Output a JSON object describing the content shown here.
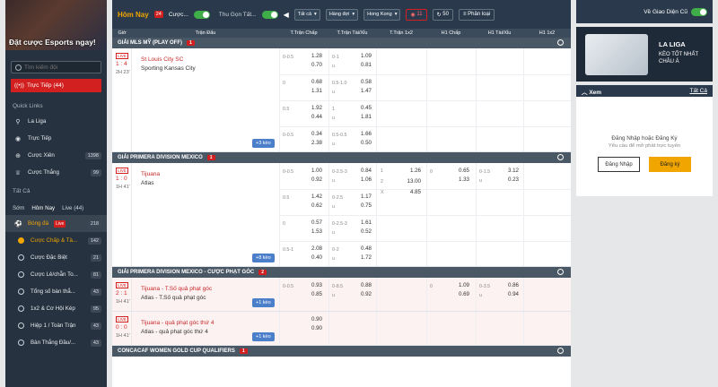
{
  "sidebar": {
    "banner_text": "Đặt cược Esports ngay!",
    "search_placeholder": "Tìm kiếm đội",
    "live_label": "Trực Tiếp (44)",
    "quick_links_title": "Quick Links",
    "quick_links": [
      {
        "label": "La Liga",
        "icon": "football-boot-icon",
        "count": ""
      },
      {
        "label": "Trực Tiếp",
        "icon": "live-signal-icon",
        "count": ""
      },
      {
        "label": "Cược Xiên",
        "icon": "parlay-icon",
        "count": "1398"
      },
      {
        "label": "Cược Thắng",
        "icon": "trophy-icon",
        "count": "99"
      }
    ],
    "all_title": "Tất Cả",
    "tabs": [
      "Sớm",
      "Hôm Nay",
      "Live (44)"
    ],
    "sport": {
      "label": "Bóng đá",
      "live": "Live",
      "count": "218"
    },
    "bet_types": [
      {
        "label": "Cược Chấp & Tà...",
        "count": "142",
        "selected": true
      },
      {
        "label": "Cược Đặc Biệt",
        "count": "21",
        "selected": false
      },
      {
        "label": "Cược Lẻ/chẵn To...",
        "count": "81",
        "selected": false
      },
      {
        "label": "Tổng số bàn thắ...",
        "count": "43",
        "selected": false
      },
      {
        "label": "1x2 & Cơ Hội Kép",
        "count": "95",
        "selected": false
      },
      {
        "label": "Hiệp 1 / Toàn Trận",
        "count": "43",
        "selected": false
      },
      {
        "label": "Bàn Thắng Đầu/...",
        "count": "43",
        "selected": false
      }
    ]
  },
  "topbar": {
    "title": "Hôm Nay",
    "count": "24",
    "filter": "Cược...",
    "collapse": "Thu Gọn Tất...",
    "select1": "Tất cả",
    "select2": "Hàng đợi",
    "select3": "Hong Kong",
    "live_count": "11",
    "timer": "50",
    "sort": "Phân loại"
  },
  "columns": [
    "Giờ",
    "Trận Đấu",
    "T.Trận Chấp",
    "T.Trận Tài/Xỉu",
    "T.Trận 1x2",
    "H1 Chấp",
    "H1 Tài/Xỉu",
    "H1 1x2"
  ],
  "leagues": [
    {
      "name": "GIẢI MLS MỸ (PLAY OFF)",
      "count": "1",
      "matches": [
        {
          "live": "LIVE",
          "score": "1 : 4",
          "clock": "2H 23'",
          "home": "St Louis City SC",
          "away": "Sporting Kansas City",
          "more": "+3 kèo",
          "lines": [
            {
              "hdp": "0-0.5",
              "h1": "1.28",
              "h2": "0.70",
              "ou": "0-1",
              "o1": "1.09",
              "o2": "0.81",
              "ul": "u"
            },
            {
              "hdp": "0",
              "h1": "0.68",
              "h2": "1.31",
              "ou": "0.5-1.0",
              "o1": "0.58",
              "o2": "1.47",
              "ul": "u"
            },
            {
              "hdp": "0.5",
              "h1": "1.92",
              "h2": "0.44",
              "ou": "1",
              "o1": "0.45",
              "o2": "1.81",
              "ul": "u"
            },
            {
              "hdp": "0-0.5",
              "h1": "0.34",
              "h2": "2.38",
              "ou": "0.5-0.5",
              "o1": "1.66",
              "o2": "0.50",
              "ul": "u"
            }
          ]
        }
      ]
    },
    {
      "name": "GIẢI PRIMERA DIVISION MEXICO",
      "count": "1",
      "matches": [
        {
          "live": "LIVE",
          "score": "1 : 0",
          "clock": "1H 41'",
          "home": "Tijuana",
          "away": "Atlas",
          "more": "+8 kèo",
          "x12": [
            {
              "k": "1",
              "v": "1.26"
            },
            {
              "k": "2",
              "v": "13.00"
            },
            {
              "k": "X",
              "v": "4.85"
            }
          ],
          "h1hdp": {
            "l": "0",
            "a": "0.65",
            "b": "1.33"
          },
          "h1ou": {
            "l": "0-1.5",
            "a": "3.12",
            "b": "0.23",
            "ul": "u"
          },
          "lines": [
            {
              "hdp": "0-0.5",
              "h1": "1.00",
              "h2": "0.92",
              "ou": "0-2.5-3",
              "o1": "0.84",
              "o2": "1.06",
              "ul": "u"
            },
            {
              "hdp": "0.5",
              "h1": "1.42",
              "h2": "0.62",
              "ou": "0-2.5",
              "o1": "1.17",
              "o2": "0.75",
              "ul": "u"
            },
            {
              "hdp": "0",
              "h1": "0.57",
              "h2": "1.53",
              "ou": "0-2.5-3",
              "o1": "1.61",
              "o2": "0.52",
              "ul": "u"
            },
            {
              "hdp": "0.5-1",
              "h1": "2.08",
              "h2": "0.40",
              "ou": "0-2",
              "o1": "0.48",
              "o2": "1.72",
              "ul": "u"
            }
          ]
        }
      ]
    },
    {
      "name": "GIẢI PRIMERA DIVISION MEXICO - CƯỢC PHẠT GÓC",
      "count": "2",
      "matches": [
        {
          "live": "LIVE",
          "score": "2 : 1",
          "clock": "1H 41'",
          "home": "Tijuana - T.Số quả phạt góc",
          "away": "Atlas - T.Số quả phạt góc",
          "more": "+1 kèo",
          "h1hdp": {
            "l": "0",
            "a": "1.09",
            "b": "0.69"
          },
          "h1ou": {
            "l": "0-3.5",
            "a": "0.86",
            "b": "0.94",
            "ul": "u"
          },
          "lines": [
            {
              "hdp": "0-0.5",
              "h1": "0.93",
              "h2": "0.85",
              "ou": "0-8.5",
              "o1": "0.88",
              "o2": "0.92",
              "ul": "u"
            }
          ]
        },
        {
          "live": "LIVE",
          "score": "0 : 0",
          "clock": "1H 41'",
          "home": "Tijuana - quả phạt góc thứ 4",
          "away": "Atlas - quả phạt góc thứ 4",
          "more": "+1 kèo",
          "lines": [
            {
              "hdp": "",
              "h1": "0.90",
              "h2": "0.90",
              "ou": "",
              "o1": "",
              "o2": "",
              "ul": ""
            }
          ]
        }
      ]
    },
    {
      "name": "CONCACAF WOMEN GOLD CUP QUALIFIERS",
      "count": "1",
      "matches": []
    }
  ],
  "right": {
    "toggle_label": "Về Giao Diện Cũ",
    "promo_title": "LA LIGA",
    "promo_line2": "KÈO TỐT NHẤT",
    "promo_line3": "CHÂU Á",
    "xem_title": "Xem",
    "xem_all": "Tất Cả",
    "login_prompt": "Đăng Nhập hoặc Đăng Ký",
    "login_sub": "Yêu cầu để mở phát trực tuyến",
    "login_btn": "Đăng Nhập",
    "register_btn": "Đăng ký"
  },
  "colors": {
    "accent": "#f0a500",
    "live": "#d21f1f",
    "header": "#2a3a4c",
    "more": "#4c7fc9"
  }
}
